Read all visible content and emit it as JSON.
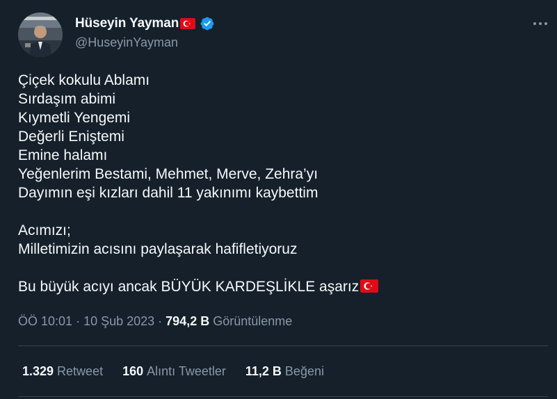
{
  "author": {
    "display_name": "Hüseyin Yayman",
    "handle": "@HuseyinYayman",
    "name_flag": "flag-turkey-icon",
    "verified_color": "#1d9bf0"
  },
  "tweet": {
    "lines": [
      "Çiçek kokulu Ablamı",
      "Sırdaşım abimi",
      "Kıymetli Yengemi",
      "Değerli Eniştemi",
      "Emine halamı",
      "Yeğenlerim Bestami, Mehmet, Merve, Zehra’yı",
      "Dayımın eşi kızları dahil 11 yakınımı kaybettim"
    ],
    "lines2": [
      "Acımızı;",
      "Milletimizin acısını paylaşarak hafifletiyoruz"
    ],
    "last_line": "Bu büyük acıyı ancak BÜYÜK KARDEŞLİKLE aşarız"
  },
  "meta": {
    "time": "ÖÖ 10:01",
    "date": "10 Şub 2023",
    "views_count": "794,2 B",
    "views_label": "Görüntülenme"
  },
  "stats": {
    "retweets_count": "1.329",
    "retweets_label": "Retweet",
    "quotes_count": "160",
    "quotes_label": "Alıntı Tweetler",
    "likes_count": "11,2 B",
    "likes_label": "Beğeni"
  },
  "colors": {
    "background": "#15202b",
    "text": "#f7f9f9",
    "secondary": "#8b98a5",
    "divider": "#38444d",
    "flag_red": "#e30a17"
  }
}
